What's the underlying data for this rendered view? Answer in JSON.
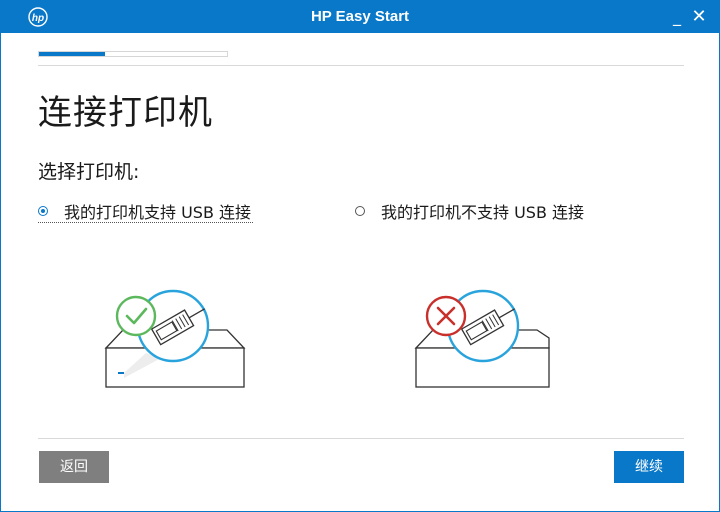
{
  "window": {
    "title": "HP Easy Start",
    "minimize_label": "_",
    "close_label": "✕"
  },
  "progress": {
    "fraction": 0.35
  },
  "main": {
    "heading": "连接打印机",
    "subheading": "选择打印机:",
    "options": [
      {
        "label": "我的打印机支持 USB 连接",
        "selected": true
      },
      {
        "label": "我的打印机不支持 USB 连接",
        "selected": false
      }
    ]
  },
  "footer": {
    "back_label": "返回",
    "next_label": "继续"
  },
  "colors": {
    "brand": "#0a78c8",
    "check_green": "#5cb85c",
    "cross_red": "#c9302c",
    "back_gray": "#7f7f7f"
  }
}
